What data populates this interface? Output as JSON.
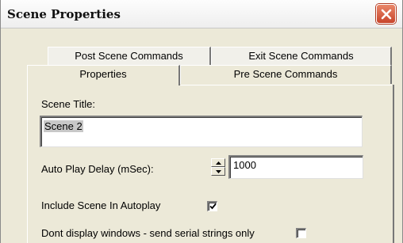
{
  "window": {
    "title": "Scene Properties",
    "close_icon": "close-icon",
    "close_color": "#d4553a"
  },
  "tabs": {
    "back_row": [
      "Post Scene Commands",
      "Exit Scene Commands"
    ],
    "front_row": [
      "Properties",
      "Pre Scene Commands"
    ],
    "active": "Properties"
  },
  "form": {
    "scene_title_label": "Scene Title:",
    "scene_title_value": "Scene 2",
    "auto_play_label": "Auto Play Delay (mSec):",
    "auto_play_value": "1000",
    "include_autoplay_label": "Include Scene In Autoplay",
    "include_autoplay_checked": true,
    "dont_display_label": "Dont display windows - send serial strings only",
    "dont_display_checked": false
  }
}
